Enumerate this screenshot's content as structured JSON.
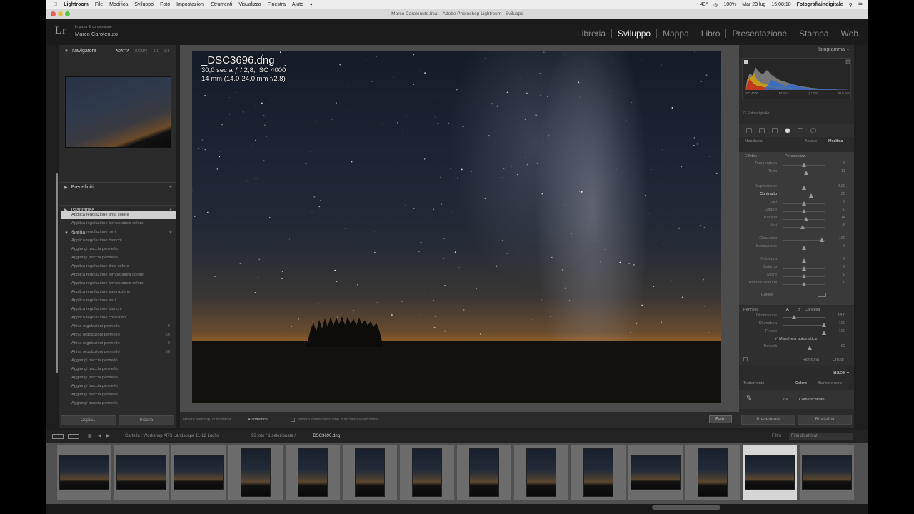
{
  "os_menubar": {
    "app": "Lightroom",
    "items": [
      "File",
      "Modifica",
      "Sviluppo",
      "Foto",
      "Impostazioni",
      "Strumenti",
      "Visualizza",
      "Finestra",
      "Aiuto"
    ],
    "right": [
      "43°",
      "100%",
      "Mar 23 lug",
      "15:08:18",
      "Fotografiaindigitale"
    ]
  },
  "window_title": "Marco Carotenuto.lrcat - Adobe Photoshop Lightroom - Sviluppo",
  "identity": {
    "logo": "Lr",
    "subtitle": "In pizza di consessione",
    "name": "Marco Carotenuto"
  },
  "modules": [
    "Libreria",
    "Sviluppo",
    "Mappa",
    "Libro",
    "Presentazione",
    "Stampa",
    "Web"
  ],
  "active_module": "Sviluppo",
  "left": {
    "navigator": {
      "title": "Navigatore",
      "zoom": [
        "ADATTA",
        "RIEMPI",
        "1:1",
        "3:1"
      ]
    },
    "panels": [
      "Predefiniti",
      "Istantanee",
      "Storia"
    ],
    "history": [
      {
        "label": "Applica regolazione tinta colore",
        "value": "",
        "selected": true
      },
      {
        "label": "Applica regolazione temperatura colore",
        "value": ""
      },
      {
        "label": "Applica regolazione neri",
        "value": ""
      },
      {
        "label": "Applica regolazione bianchi",
        "value": ""
      },
      {
        "label": "Aggiungi traccia pennello",
        "value": ""
      },
      {
        "label": "Aggiungi traccia pennello",
        "value": ""
      },
      {
        "label": "Applica regolazione tinta colore",
        "value": ""
      },
      {
        "label": "Applica regolazione temperatura colore",
        "value": ""
      },
      {
        "label": "Applica regolazione temperatura colore",
        "value": ""
      },
      {
        "label": "Applica regolazione saturazione",
        "value": ""
      },
      {
        "label": "Applica regolazione neri",
        "value": ""
      },
      {
        "label": "Applica regolazione bianchi",
        "value": ""
      },
      {
        "label": "Applica regolazione contrasto",
        "value": ""
      },
      {
        "label": "Attiva regolazioni pennello",
        "value": "0"
      },
      {
        "label": "Attiva regolazioni pennello",
        "value": "50"
      },
      {
        "label": "Attiva regolazioni pennello",
        "value": "0"
      },
      {
        "label": "Attiva regolazioni pennello",
        "value": "50"
      },
      {
        "label": "Aggiungi traccia pennello",
        "value": ""
      },
      {
        "label": "Aggiungi traccia pennello",
        "value": ""
      },
      {
        "label": "Aggiungi traccia pennello",
        "value": ""
      },
      {
        "label": "Aggiungi traccia pennello",
        "value": ""
      },
      {
        "label": "Aggiungi traccia pennello",
        "value": ""
      },
      {
        "label": "Aggiungi traccia pennello",
        "value": ""
      }
    ],
    "buttons": {
      "copy": "Copia...",
      "paste": "Incolla"
    }
  },
  "photo": {
    "filename": "_DSC3696.dng",
    "exposure": "30,0 sec a ƒ / 2,8, ISO 4000",
    "lens": "14 mm (14.0-24.0 mm f/2.8)"
  },
  "center_toolbar": {
    "mask_label": "Mostra sovrapp. di modifica:",
    "mask_value": "Automatico",
    "hint": "Mostra sovrapposizione maschera selezionata",
    "done": "Fatto"
  },
  "right": {
    "histogram_title": "Istogramma",
    "hist_readout": [
      "ISO 4000",
      "14 mm",
      "ƒ / 2,8",
      "30,0 sec"
    ],
    "original_photo": "Foto originale",
    "mask_header": {
      "left": "Maschera:",
      "new": "Nuovo",
      "edit": "Modifica"
    },
    "effect": {
      "label": "Effetto:",
      "value": "Personalizz."
    },
    "sliders": [
      {
        "label": "Temperatura",
        "value": "0",
        "pos": 0.5
      },
      {
        "label": "Tinta",
        "value": "11",
        "pos": 0.55
      },
      {
        "label": "Esposizione",
        "value": "0,00",
        "pos": 0.5
      },
      {
        "label": "Contrasto",
        "value": "36",
        "pos": 0.68,
        "active": true
      },
      {
        "label": "Luci",
        "value": "0",
        "pos": 0.5
      },
      {
        "label": "Ombre",
        "value": "0",
        "pos": 0.5
      },
      {
        "label": "Bianchi",
        "value": "14",
        "pos": 0.56
      },
      {
        "label": "Neri",
        "value": "-8",
        "pos": 0.46
      },
      {
        "label": "Chiarezza",
        "value": "100",
        "pos": 0.93
      },
      {
        "label": "Saturazione",
        "value": "0",
        "pos": 0.5
      },
      {
        "label": "Nitidezza",
        "value": "0",
        "pos": 0.5
      },
      {
        "label": "Disturbo",
        "value": "0",
        "pos": 0.5
      },
      {
        "label": "Moiré",
        "value": "0",
        "pos": 0.5
      },
      {
        "label": "Rimuovi disturbi",
        "value": "0",
        "pos": 0.5
      }
    ],
    "color_label": "Colore",
    "brush": {
      "title": "Pennello :",
      "a": "A",
      "b": "B",
      "erase": "Cancella",
      "sliders": [
        {
          "label": "Dimensione",
          "value": "18,0"
        },
        {
          "label": "Sfumatura",
          "value": "100"
        },
        {
          "label": "Flusso",
          "value": "100"
        }
      ],
      "auto_mask": "Maschera automatica",
      "density_label": "Densità",
      "density_value": "62"
    },
    "reset": "Ripristina",
    "close": "Chiudi",
    "basic": "Base",
    "treatment": {
      "label": "Trattamento:",
      "color": "Colore",
      "bw": "Bianco e nero"
    },
    "profile": {
      "wb": "Bil.",
      "value": "Come scattato"
    },
    "buttons": {
      "prev": "Precedente",
      "reset": "Ripristina"
    }
  },
  "filmstrip": {
    "source": "Cartella : Workshop ARS Landscape 11-12 Luglio",
    "count": "98 foto / 1 selezionata /",
    "file": "_DSC3696.dng",
    "filter_label": "Filtro :",
    "filter_value": "Filtri disattivati"
  }
}
